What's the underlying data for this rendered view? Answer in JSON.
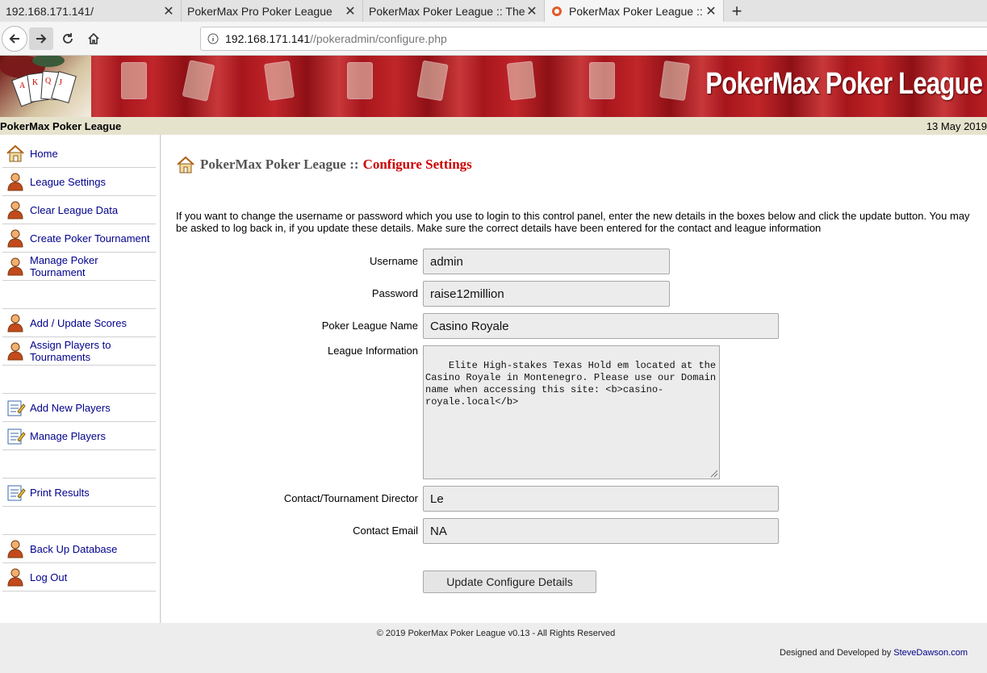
{
  "browser": {
    "tabs": [
      {
        "label": "192.168.171.141/"
      },
      {
        "label": "PokerMax Pro Poker League"
      },
      {
        "label": "PokerMax Poker League :: The"
      },
      {
        "label": "PokerMax Poker League :: "
      }
    ],
    "url_host": "192.168.171.141",
    "url_path": "//pokeradmin/configure.php"
  },
  "banner": {
    "title": "PokerMax Poker League"
  },
  "status": {
    "site_name": "PokerMax Poker League",
    "date": "13 May 2019"
  },
  "sidebar": {
    "items": [
      {
        "label": "Home",
        "icon": "house-icon"
      },
      {
        "label": "League Settings",
        "icon": "person-icon"
      },
      {
        "label": "Clear League Data",
        "icon": "person-icon"
      },
      {
        "label": "Create Poker Tournament",
        "icon": "person-icon"
      },
      {
        "label": "Manage Poker Tournament",
        "icon": "person-icon"
      },
      {
        "label": "Add / Update Scores",
        "icon": "person-icon"
      },
      {
        "label": "Assign Players to Tournaments",
        "icon": "person-icon"
      },
      {
        "label": "Add New Players",
        "icon": "notepad-icon"
      },
      {
        "label": "Manage Players",
        "icon": "notepad-icon"
      },
      {
        "label": "Print Results",
        "icon": "notepad-icon"
      },
      {
        "label": "Back Up Database",
        "icon": "person-icon"
      },
      {
        "label": "Log Out",
        "icon": "person-icon"
      }
    ]
  },
  "page": {
    "title_prefix": "PokerMax Poker League ::",
    "title_main": "Configure Settings",
    "intro": "If you want to change the username or password which you use to login to this control panel, enter the new details in the boxes below and click the update button. You may be asked to log back in, if you update these details. Make sure the correct details have been entered for the contact and league information"
  },
  "form": {
    "username_label": "Username",
    "username_value": "admin",
    "password_label": "Password",
    "password_value": "raise12million",
    "league_name_label": "Poker League Name",
    "league_name_value": "Casino Royale",
    "league_info_label": "League Information",
    "league_info_value": "Elite High-stakes Texas Hold em located at the\nCasino Royale in Montenegro. Please use our Domain\nname when accessing this site: <b>casino-\nroyale.local</b>",
    "director_label": "Contact/Tournament Director",
    "director_value": "Le",
    "email_label": "Contact Email",
    "email_value": "NA",
    "submit_label": "Update Configure Details"
  },
  "footer": {
    "copyright": "© 2019 PokerMax Poker League v0.13 - All Rights Reserved",
    "credit_prefix": "Designed and Developed by",
    "credit_link": "SteveDawson.com"
  }
}
